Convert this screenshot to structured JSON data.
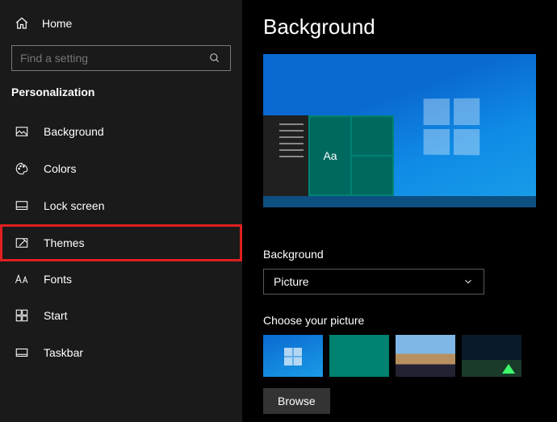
{
  "home_label": "Home",
  "search": {
    "placeholder": "Find a setting"
  },
  "section_title": "Personalization",
  "nav": [
    {
      "key": "background",
      "label": "Background"
    },
    {
      "key": "colors",
      "label": "Colors"
    },
    {
      "key": "lockscreen",
      "label": "Lock screen"
    },
    {
      "key": "themes",
      "label": "Themes"
    },
    {
      "key": "fonts",
      "label": "Fonts"
    },
    {
      "key": "start",
      "label": "Start"
    },
    {
      "key": "taskbar",
      "label": "Taskbar"
    }
  ],
  "page_title": "Background",
  "background_label": "Background",
  "dropdown_value": "Picture",
  "choose_label": "Choose your picture",
  "browse_label": "Browse",
  "preview_tile_text": "Aa"
}
